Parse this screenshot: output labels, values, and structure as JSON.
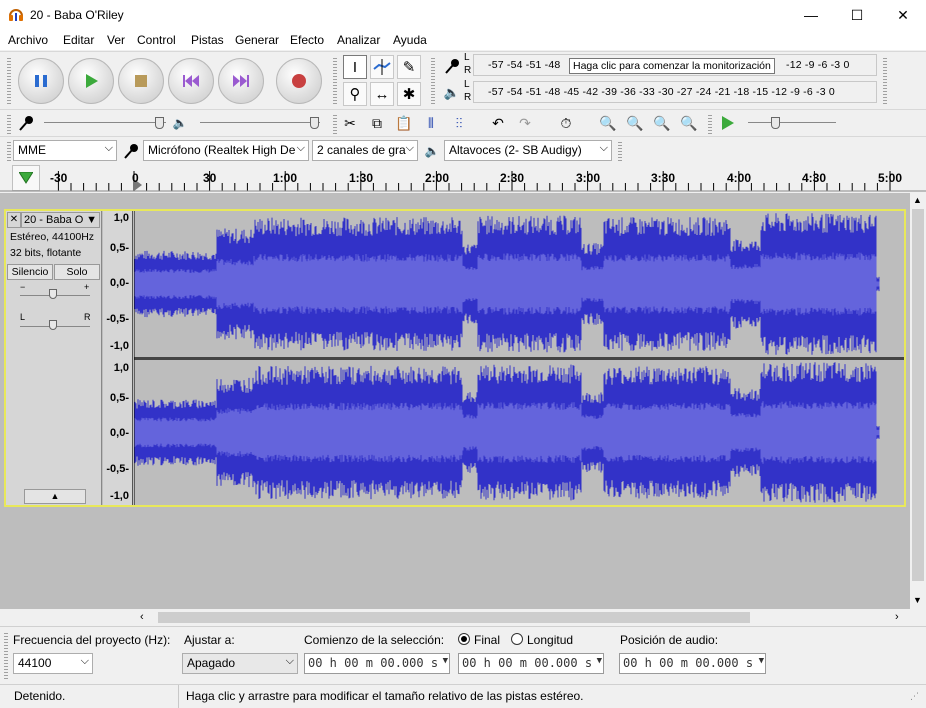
{
  "window": {
    "title": "20 - Baba O'Riley",
    "minimize": "—",
    "maximize": "☐",
    "close": "✕"
  },
  "menu": [
    "Archivo",
    "Editar",
    "Ver",
    "Control",
    "Pistas",
    "Generar",
    "Efecto",
    "Analizar",
    "Ayuda"
  ],
  "meters": {
    "record_ticks": "-57 -54 -51 -48",
    "record_ticks_right": "-12  -9  -6  -3  0",
    "monitor_hint": "Haga clic para comenzar la monitorización",
    "play_ticks": "-57 -54 -51 -48 -45 -42 -39 -36 -33 -30 -27 -24 -21 -18 -15 -12  -9  -6  -3  0",
    "channel_l": "L",
    "channel_r": "R"
  },
  "devices": {
    "host": "MME",
    "mic": "Micrófono (Realtek High De",
    "channels": "2 canales de gra",
    "speakers": "Altavoces (2- SB Audigy)"
  },
  "ruler": {
    "labels": [
      "-30",
      "0",
      "30",
      "1:00",
      "1:30",
      "2:00",
      "2:30",
      "3:00",
      "3:30",
      "4:00",
      "4:30",
      "5:00"
    ]
  },
  "track": {
    "close": "✕",
    "name": "20 - Baba O",
    "info1": "Estéreo, 44100Hz",
    "info2": "32 bits, flotante",
    "mute": "Silencio",
    "solo": "Solo",
    "gain_minus": "−",
    "gain_plus": "+",
    "pan_l": "L",
    "pan_r": "R",
    "collapse": "▲",
    "scale": [
      "1,0",
      "0,5-",
      "0,0-",
      "-0,5-",
      "-1,0"
    ],
    "colors": {
      "wave": "#3232c8",
      "wave_rms": "#6464dc",
      "bg": "#bdbdbd",
      "selected_border": "#e8e85a"
    }
  },
  "bottom": {
    "rate_label": "Frecuencia del proyecto (Hz):",
    "rate_value": "44100",
    "snap_label": "Ajustar a:",
    "snap_value": "Apagado",
    "sel_label": "Comienzo de la selección:",
    "end_label": "Final",
    "len_label": "Longitud",
    "sel_start": "00 h 00 m 00.000 s",
    "sel_end": "00 h 00 m 00.000 s",
    "pos_label": "Posición de audio:",
    "pos_value": "00 h 00 m 00.000 s"
  },
  "status": {
    "state": "Detenido.",
    "hint": "Haga clic y arrastre para modificar el tamaño relativo de las pistas estéreo."
  }
}
